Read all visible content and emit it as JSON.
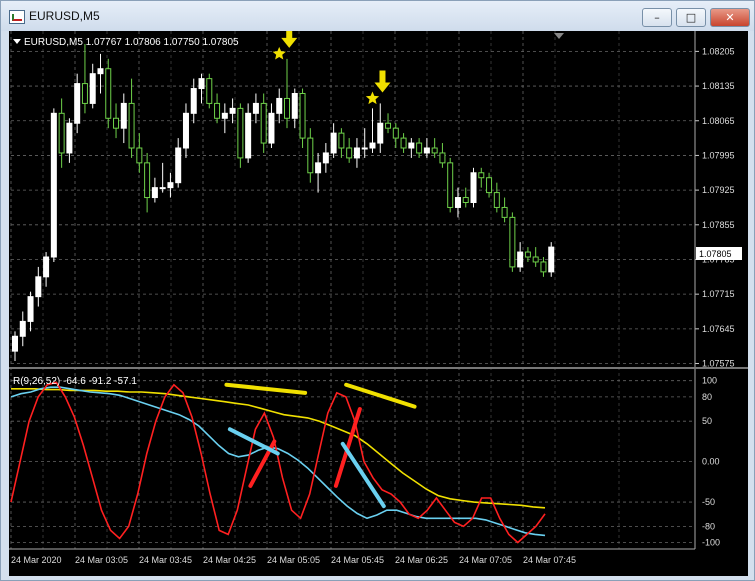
{
  "window": {
    "title": "EURUSD,M5",
    "minimize_label": "–",
    "maximize_label": "□",
    "close_label": "✕"
  },
  "main_panel": {
    "header": "EURUSD,M5  1.07767 1.07806 1.07750 1.07805",
    "current_price": "1.07805"
  },
  "indicator_panel": {
    "header": "R(9,26,52) -64.6 -91.2 -57.1"
  },
  "x_axis_labels": [
    "24 Mar 2020",
    "24 Mar 03:05",
    "24 Mar 03:45",
    "24 Mar 04:25",
    "24 Mar 05:05",
    "24 Mar 05:45",
    "24 Mar 06:25",
    "24 Mar 07:05",
    "24 Mar 07:45"
  ],
  "colors": {
    "background": "#000000",
    "bull_candle": "#ffffff",
    "bear_candle": "#6fd24a",
    "fast_line": "#ff2020",
    "mid_line": "#6ad0f0",
    "slow_line": "#f0e000",
    "annotation_arrow": "#f0e000"
  },
  "chart_data": [
    {
      "type": "candlestick",
      "symbol": "EURUSD",
      "timeframe": "M5",
      "y_ticks": [
        "1.08205",
        "1.08135",
        "1.08065",
        "1.07995",
        "1.07925",
        "1.07855",
        "1.07785",
        "1.07715",
        "1.07645",
        "1.07575"
      ],
      "ylim": [
        1.0757,
        1.0823
      ],
      "x_tick_labels": [
        "24 Mar 2020",
        "24 Mar 03:05",
        "24 Mar 03:45",
        "24 Mar 04:25",
        "24 Mar 05:05",
        "24 Mar 05:45",
        "24 Mar 06:25",
        "24 Mar 07:05",
        "24 Mar 07:45"
      ],
      "candles": [
        [
          1.076,
          1.0764,
          1.0758,
          1.0763
        ],
        [
          1.0763,
          1.0768,
          1.0761,
          1.0766
        ],
        [
          1.0766,
          1.0772,
          1.0764,
          1.0771
        ],
        [
          1.0771,
          1.0777,
          1.0769,
          1.0775
        ],
        [
          1.0775,
          1.078,
          1.0773,
          1.0779
        ],
        [
          1.0779,
          1.0809,
          1.0778,
          1.0808
        ],
        [
          1.0808,
          1.0811,
          1.0797,
          1.08
        ],
        [
          1.08,
          1.0807,
          1.0798,
          1.0806
        ],
        [
          1.0806,
          1.0816,
          1.0804,
          1.0814
        ],
        [
          1.0814,
          1.0822,
          1.0808,
          1.081
        ],
        [
          1.081,
          1.0818,
          1.0809,
          1.0816
        ],
        [
          1.0816,
          1.082,
          1.0812,
          1.0817
        ],
        [
          1.0817,
          1.0819,
          1.0805,
          1.0807
        ],
        [
          1.0807,
          1.081,
          1.0803,
          1.0805
        ],
        [
          1.0805,
          1.0812,
          1.0802,
          1.081
        ],
        [
          1.081,
          1.0815,
          1.0799,
          1.0801
        ],
        [
          1.0801,
          1.0804,
          1.0796,
          1.0798
        ],
        [
          1.0798,
          1.08,
          1.0788,
          1.0791
        ],
        [
          1.0791,
          1.0795,
          1.079,
          1.0793
        ],
        [
          1.0793,
          1.0798,
          1.0792,
          1.0793
        ],
        [
          1.0793,
          1.0796,
          1.0791,
          1.0794
        ],
        [
          1.0794,
          1.0803,
          1.0793,
          1.0801
        ],
        [
          1.0801,
          1.081,
          1.0799,
          1.0808
        ],
        [
          1.0808,
          1.0815,
          1.0806,
          1.0813
        ],
        [
          1.0813,
          1.0816,
          1.081,
          1.0815
        ],
        [
          1.0815,
          1.0816,
          1.0809,
          1.081
        ],
        [
          1.081,
          1.0812,
          1.0806,
          1.0807
        ],
        [
          1.0807,
          1.081,
          1.0804,
          1.0808
        ],
        [
          1.0808,
          1.0811,
          1.0806,
          1.0809
        ],
        [
          1.0809,
          1.081,
          1.0797,
          1.0799
        ],
        [
          1.0799,
          1.081,
          1.0798,
          1.0808
        ],
        [
          1.0808,
          1.0812,
          1.0806,
          1.081
        ],
        [
          1.081,
          1.0812,
          1.08,
          1.0802
        ],
        [
          1.0802,
          1.081,
          1.0801,
          1.0808
        ],
        [
          1.0808,
          1.0813,
          1.0806,
          1.0811
        ],
        [
          1.0811,
          1.0819,
          1.0805,
          1.0807
        ],
        [
          1.0807,
          1.0813,
          1.0805,
          1.0812
        ],
        [
          1.0812,
          1.0813,
          1.0801,
          1.0803
        ],
        [
          1.0803,
          1.0805,
          1.0794,
          1.0796
        ],
        [
          1.0796,
          1.08,
          1.0792,
          1.0798
        ],
        [
          1.0798,
          1.0802,
          1.0796,
          1.08
        ],
        [
          1.08,
          1.0806,
          1.0799,
          1.0804
        ],
        [
          1.0804,
          1.0805,
          1.0799,
          1.0801
        ],
        [
          1.0801,
          1.0803,
          1.0798,
          1.0799
        ],
        [
          1.0799,
          1.0803,
          1.0797,
          1.0801
        ],
        [
          1.0801,
          1.0805,
          1.0799,
          1.0801
        ],
        [
          1.0801,
          1.0809,
          1.08,
          1.0802
        ],
        [
          1.0802,
          1.081,
          1.08,
          1.0806
        ],
        [
          1.0806,
          1.0808,
          1.0804,
          1.0805
        ],
        [
          1.0805,
          1.0806,
          1.0801,
          1.0803
        ],
        [
          1.0803,
          1.0804,
          1.08,
          1.0801
        ],
        [
          1.0801,
          1.0803,
          1.0799,
          1.0802
        ],
        [
          1.0802,
          1.0803,
          1.0799,
          1.08
        ],
        [
          1.08,
          1.0803,
          1.0799,
          1.0801
        ],
        [
          1.0801,
          1.0803,
          1.0799,
          1.08
        ],
        [
          1.08,
          1.0802,
          1.0797,
          1.0798
        ],
        [
          1.0798,
          1.0799,
          1.0788,
          1.0789
        ],
        [
          1.0789,
          1.0793,
          1.0787,
          1.0791
        ],
        [
          1.0791,
          1.0793,
          1.0789,
          1.079
        ],
        [
          1.079,
          1.0797,
          1.0789,
          1.0796
        ],
        [
          1.0796,
          1.0797,
          1.0793,
          1.0795
        ],
        [
          1.0795,
          1.0796,
          1.0791,
          1.0792
        ],
        [
          1.0792,
          1.0794,
          1.0788,
          1.0789
        ],
        [
          1.0789,
          1.0791,
          1.0786,
          1.0787
        ],
        [
          1.0787,
          1.0788,
          1.0776,
          1.0777
        ],
        [
          1.0777,
          1.0782,
          1.0776,
          1.078
        ],
        [
          1.078,
          1.0781,
          1.0778,
          1.0779
        ],
        [
          1.0779,
          1.0781,
          1.0777,
          1.0778
        ],
        [
          1.0778,
          1.0779,
          1.0775,
          1.0776
        ],
        [
          1.0776,
          1.0782,
          1.0775,
          1.0781
        ]
      ],
      "star_markers": [
        {
          "index": 34,
          "price": 1.082
        },
        {
          "index": 46,
          "price": 1.0811
        }
      ]
    },
    {
      "type": "line",
      "title": "R(9,26,52)",
      "y_ticks": [
        100,
        80,
        50,
        0,
        -50,
        -80,
        -100
      ],
      "y_tick_labels": [
        "100",
        "80",
        "50",
        "0.00",
        "-50",
        "-80",
        "-100"
      ],
      "ylim": [
        -108,
        112
      ],
      "last_values": [
        -64.6,
        -91.2,
        -57.1
      ],
      "series": [
        {
          "values": [
            -50,
            0,
            50,
            80,
            95,
            98,
            80,
            55,
            20,
            -20,
            -60,
            -85,
            -95,
            -80,
            -40,
            10,
            50,
            80,
            95,
            85,
            55,
            10,
            -40,
            -85,
            -90,
            -60,
            -10,
            40,
            60,
            30,
            -20,
            -60,
            -70,
            -40,
            10,
            60,
            85,
            80,
            50,
            0,
            -20,
            -35,
            -40,
            -50,
            -65,
            -70,
            -60,
            -45,
            -60,
            -75,
            -80,
            -70,
            -45,
            -45,
            -70,
            -90,
            -100,
            -90,
            -80,
            -64.6
          ]
        },
        {
          "values": [
            80,
            84,
            86,
            90,
            92,
            92,
            90,
            88,
            86,
            85,
            84,
            82,
            78,
            74,
            70,
            66,
            62,
            58,
            52,
            44,
            32,
            20,
            10,
            6,
            8,
            14,
            18,
            16,
            10,
            2,
            -8,
            -20,
            -32,
            -44,
            -55,
            -64,
            -70,
            -66,
            -60,
            -60,
            -64,
            -68,
            -70,
            -70,
            -70,
            -70,
            -70,
            -70,
            -72,
            -76,
            -80,
            -84,
            -88,
            -90,
            -91.2
          ]
        },
        {
          "values": [
            90,
            90,
            90,
            89,
            89,
            88,
            88,
            88,
            87,
            87,
            86,
            86,
            85,
            84,
            82,
            80,
            78,
            76,
            74,
            72,
            70,
            66,
            62,
            58,
            56,
            54,
            50,
            44,
            38,
            32,
            22,
            10,
            -2,
            -14,
            -24,
            -34,
            -42,
            -46,
            -48,
            -50,
            -51,
            -52,
            -53,
            -54,
            -56,
            -57.1
          ]
        }
      ],
      "annotations": [
        {
          "shape": "line",
          "color": "#f0e000",
          "x": [
            0.315,
            0.43
          ],
          "y": [
            95,
            85
          ]
        },
        {
          "shape": "line",
          "color": "#f0e000",
          "x": [
            0.49,
            0.59
          ],
          "y": [
            95,
            68
          ]
        },
        {
          "shape": "line",
          "color": "#ff2020",
          "x": [
            0.35,
            0.385
          ],
          "y": [
            -30,
            25
          ]
        },
        {
          "shape": "line",
          "color": "#ff2020",
          "x": [
            0.475,
            0.51
          ],
          "y": [
            -30,
            65
          ]
        },
        {
          "shape": "line",
          "color": "#6ad0f0",
          "x": [
            0.32,
            0.39
          ],
          "y": [
            40,
            10
          ]
        },
        {
          "shape": "line",
          "color": "#6ad0f0",
          "x": [
            0.485,
            0.545
          ],
          "y": [
            22,
            -55
          ]
        }
      ]
    }
  ]
}
